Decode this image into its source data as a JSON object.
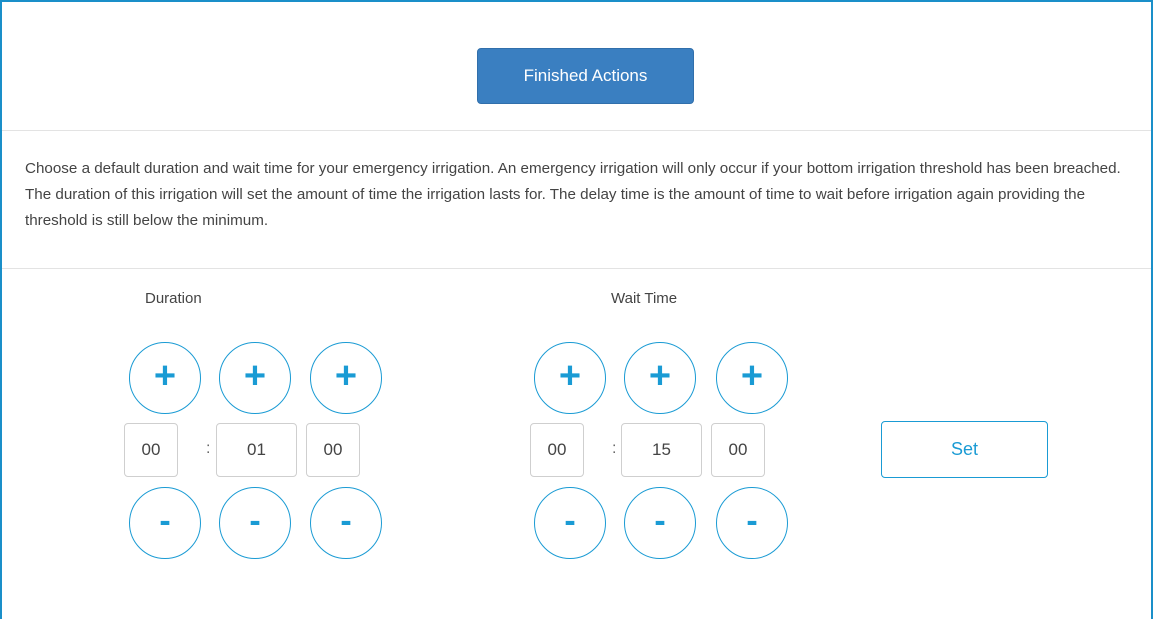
{
  "header": {
    "finished_label": "Finished Actions"
  },
  "description": "Choose a default duration and wait time for your emergency irrigation. An emergency irrigation will only occur if your bottom irrigation threshold has been breached. The duration of this irrigation will set the amount of time the irrigation lasts for. The delay time is the amount of time to wait before irrigation again providing the threshold is still below the minimum.",
  "duration": {
    "label": "Duration",
    "hours": "00",
    "minutes": "01",
    "seconds": "00"
  },
  "wait_time": {
    "label": "Wait Time",
    "hours": "00",
    "minutes": "15",
    "seconds": "00"
  },
  "controls": {
    "plus_symbol": "+",
    "minus_symbol": "-",
    "separator": ":"
  },
  "set_label": "Set",
  "colors": {
    "accent": "#1a9bd4",
    "primary_button": "#3a7fc1",
    "frame": "#1a8fc9"
  }
}
